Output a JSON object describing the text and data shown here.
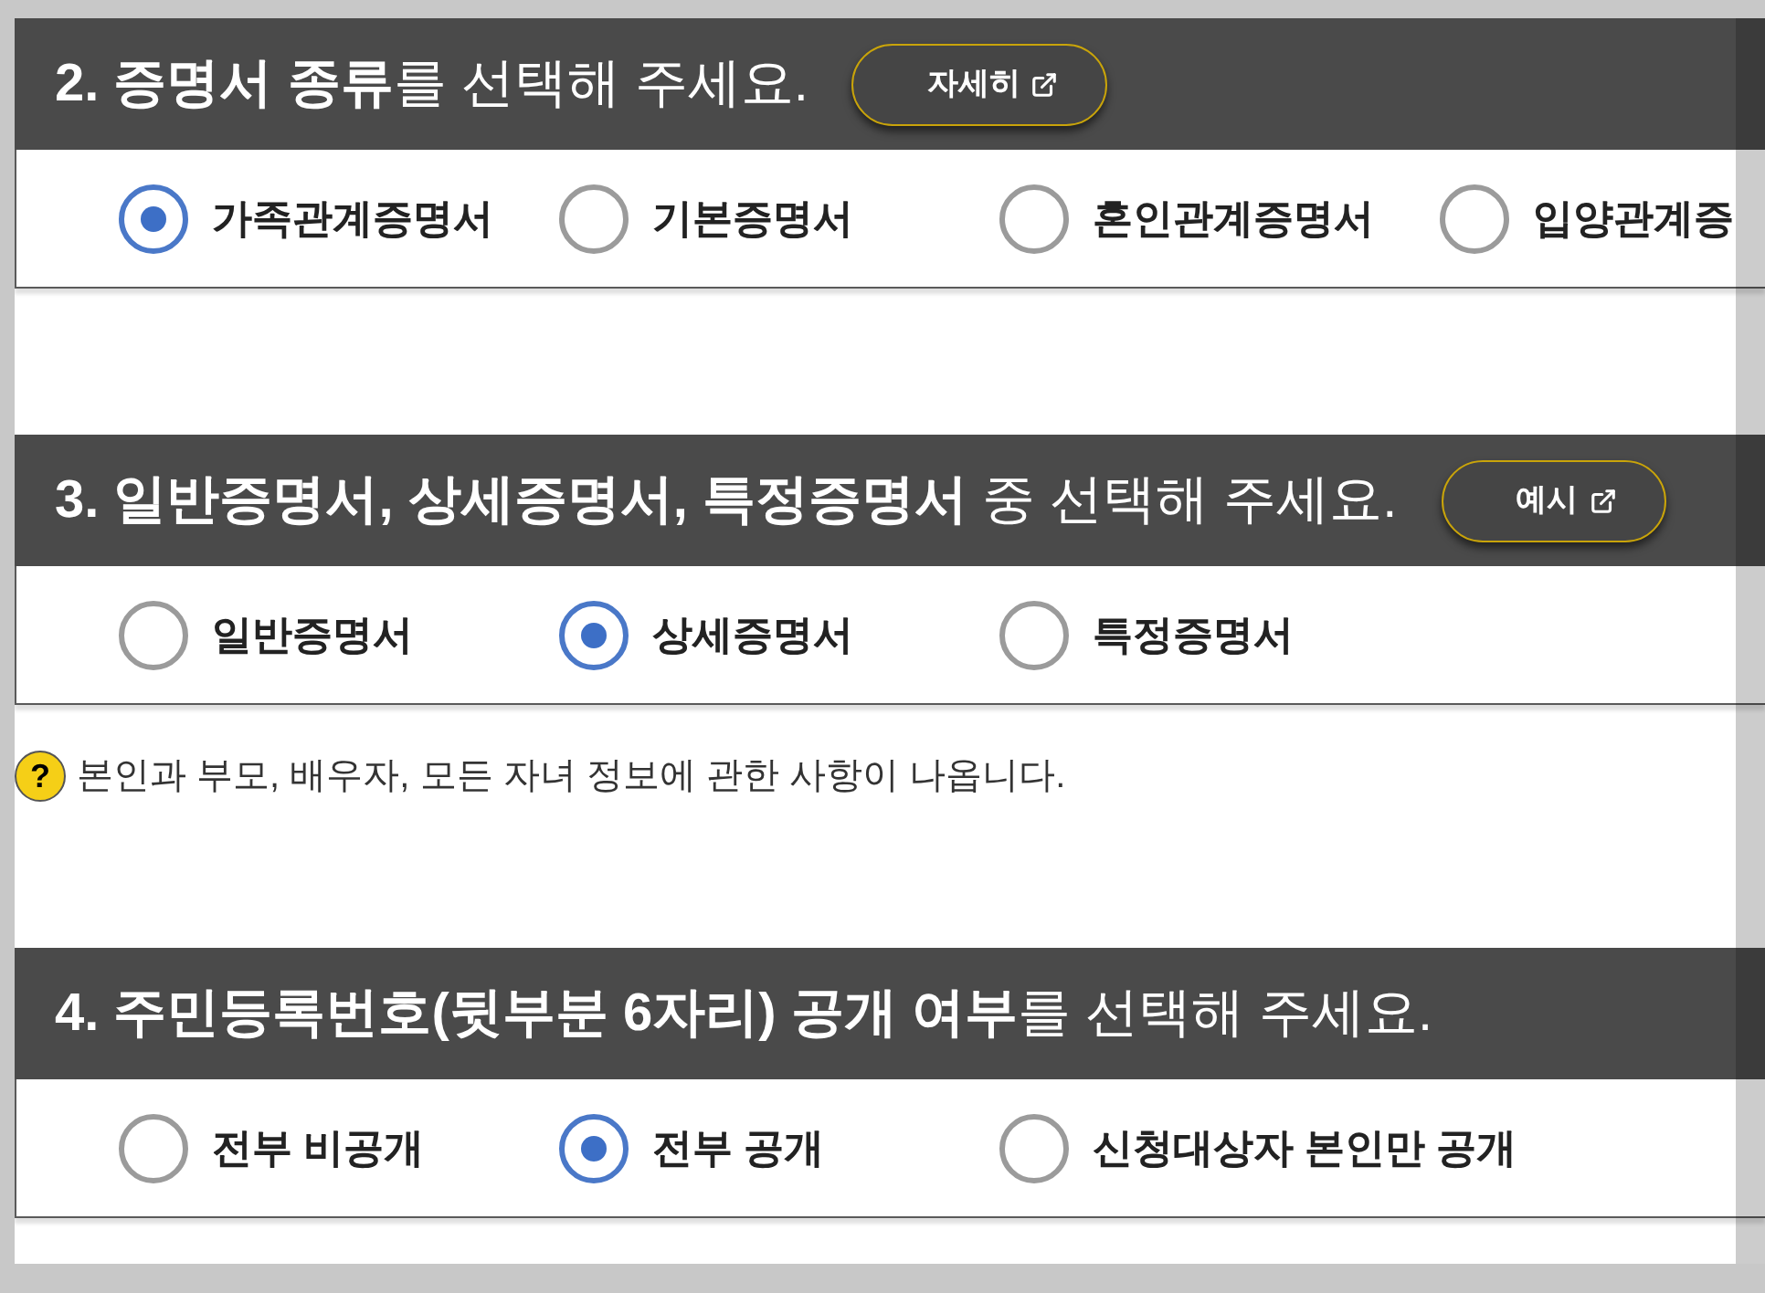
{
  "sections": [
    {
      "title": "**2. 증명서 종류**를 선택해 주세요.",
      "button": {
        "label": "자세히"
      },
      "options": [
        {
          "label": "가족관계증명서",
          "selected": true
        },
        {
          "label": "기본증명서",
          "selected": false
        },
        {
          "label": "혼인관계증명서",
          "selected": false
        },
        {
          "label": "입양관계증",
          "selected": false
        }
      ]
    },
    {
      "title": "**3. 일반증명서, 상세증명서, 특정증명서** 중 선택해 주세요.",
      "button": {
        "label": "예시"
      },
      "options": [
        {
          "label": "일반증명서",
          "selected": false
        },
        {
          "label": "상세증명서",
          "selected": true
        },
        {
          "label": "특정증명서",
          "selected": false
        }
      ],
      "note": {
        "icon": "?",
        "text": "본인과 부모, 배우자, 모든 자녀 정보에 관한 사항이 나옵니다."
      }
    },
    {
      "title": "**4. 주민등록번호(뒷부분 6자리) 공개 여부**를 선택해 주세요.",
      "options": [
        {
          "label": "전부 비공개",
          "selected": false
        },
        {
          "label": "전부 공개",
          "selected": true
        },
        {
          "label": "신청대상자 본인만 공개",
          "selected": false
        }
      ]
    }
  ]
}
